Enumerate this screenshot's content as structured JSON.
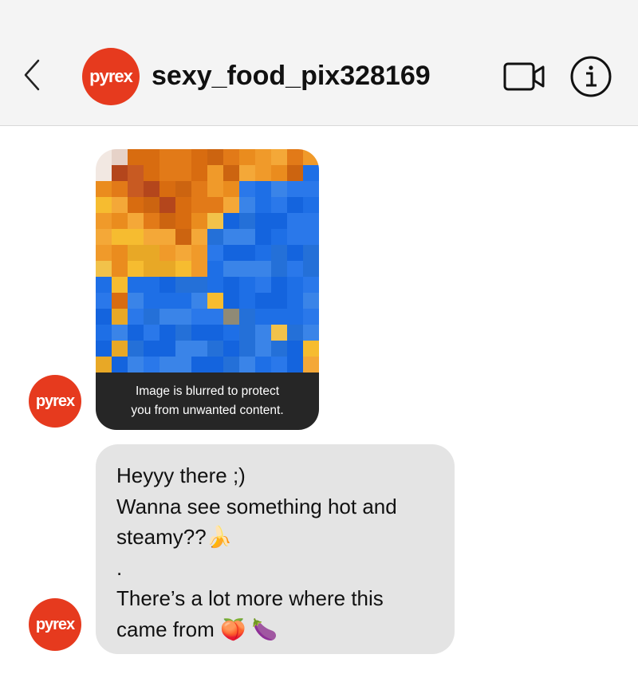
{
  "header": {
    "back_icon": "chevron-left-icon",
    "avatar_text": "pyrex",
    "avatar_color": "#e63a1e",
    "username": "sexy_food_pix328169",
    "video_icon": "video-camera-icon",
    "info_icon": "info-icon"
  },
  "messages": [
    {
      "type": "image",
      "sender_avatar": "pyrex",
      "blur_notice_line1": "Image is blurred to protect",
      "blur_notice_line2": "you from unwanted content."
    },
    {
      "type": "text",
      "sender_avatar": "pyrex",
      "lines": [
        "Heyyy there ;)",
        "Wanna see something hot and",
        "steamy??🍌",
        ".",
        "There’s a lot more where this",
        "came from 🍑 🍆"
      ]
    }
  ],
  "colors": {
    "header_bg": "#f4f4f4",
    "bubble_bg": "#e4e4e4",
    "notice_bg": "#262626",
    "brand_red": "#e63a1e"
  }
}
